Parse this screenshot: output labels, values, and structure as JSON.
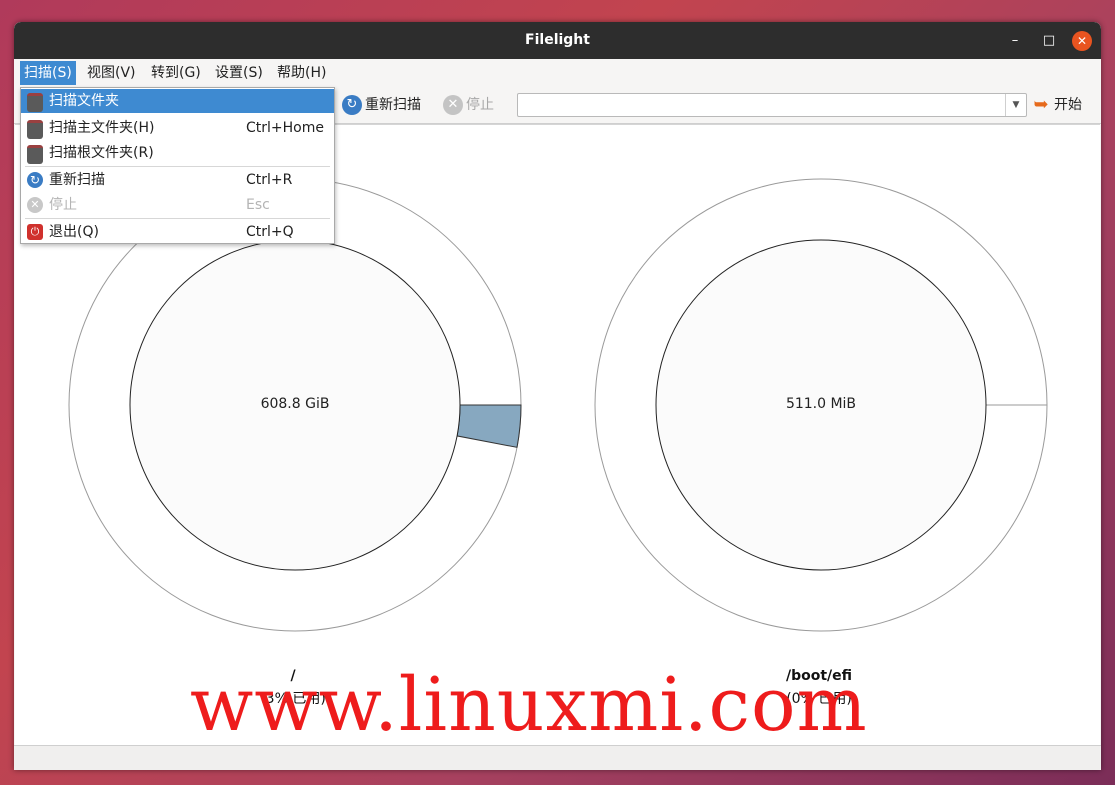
{
  "window": {
    "title": "Filelight",
    "min_glyph": "–",
    "max_glyph": "□",
    "close_glyph": "✕"
  },
  "menubar": {
    "items": [
      {
        "label": "扫描(S)"
      },
      {
        "label": "视图(V)"
      },
      {
        "label": "转到(G)"
      },
      {
        "label": "设置(S)"
      },
      {
        "label": "帮助(H)"
      }
    ]
  },
  "toolbar": {
    "rescan_label": "重新扫描",
    "stop_label": "停止",
    "path_value": "",
    "go_label": "开始"
  },
  "scan_menu": {
    "items": [
      {
        "label": "扫描文件夹",
        "shortcut": ""
      },
      {
        "label": "扫描主文件夹(H)",
        "shortcut": "Ctrl+Home"
      },
      {
        "label": "扫描根文件夹(R)",
        "shortcut": ""
      },
      {
        "label": "重新扫描",
        "shortcut": "Ctrl+R"
      },
      {
        "label": "停止",
        "shortcut": "Esc"
      },
      {
        "label": "退出(Q)",
        "shortcut": "Ctrl+Q"
      }
    ]
  },
  "disks": [
    {
      "name": "/",
      "size": "608.8 GiB",
      "usage": "(3% 已用)",
      "used_fraction": 0.03,
      "used_color": "#87a8c0"
    },
    {
      "name": "/boot/efi",
      "size": "511.0 MiB",
      "usage": "(0% 已用)",
      "used_fraction": 0.0,
      "used_color": "#87a8c0"
    }
  ],
  "watermark": "www.linuxmi.com",
  "colors": {
    "accent": "#3e8ad1",
    "titlebar": "#2d2d2d",
    "close": "#e95420",
    "watermark": "#ee1c1c"
  }
}
